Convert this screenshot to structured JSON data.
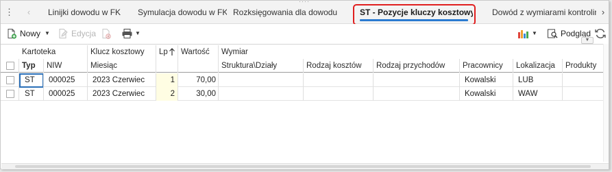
{
  "tabs": [
    {
      "label": "Linijki dowodu w FK"
    },
    {
      "label": "Symulacja dowodu w FK"
    },
    {
      "label": "Rozksięgowania dla dowodu"
    },
    {
      "label": "ST - Pozycje kluczy kosztowych"
    },
    {
      "label": "Dowód z wymiarami kontrolingo"
    }
  ],
  "active_tab": "ST - Pozycje kluczy kosztowych",
  "colors": {
    "accent": "#2a7bd1",
    "highlight_frame": "#e01e1e",
    "lp_background": "#fffde3"
  },
  "toolbar": {
    "new_label": "Nowy",
    "edit_label": "Edycja",
    "preview_label": "Podgląd"
  },
  "grid": {
    "header_row1": {
      "kartoteka": "Kartoteka",
      "klucz": "Klucz kosztowy",
      "lp": "Lp",
      "wartosc": "Wartość",
      "wymiar": "Wymiar"
    },
    "header_row2": {
      "typ": "Typ",
      "niw": "NIW",
      "miesiac": "Miesiąc",
      "struktura": "Struktura\\Działy",
      "rodzaj_kosztow": "Rodzaj kosztów",
      "rodzaj_przychodow": "Rodzaj przychodów",
      "pracownicy": "Pracownicy",
      "lokalizacja": "Lokalizacja",
      "produkty": "Produkty"
    },
    "rows": [
      {
        "typ": "ST",
        "niw": "000025",
        "miesiac": "2023 Czerwiec",
        "lp": "1",
        "wartosc": "70,00",
        "pracownicy": "Kowalski",
        "lokalizacja": "LUB"
      },
      {
        "typ": "ST",
        "niw": "000025",
        "miesiac": "2023 Czerwiec",
        "lp": "2",
        "wartosc": "30,00",
        "pracownicy": "Kowalski",
        "lokalizacja": "WAW"
      }
    ]
  }
}
